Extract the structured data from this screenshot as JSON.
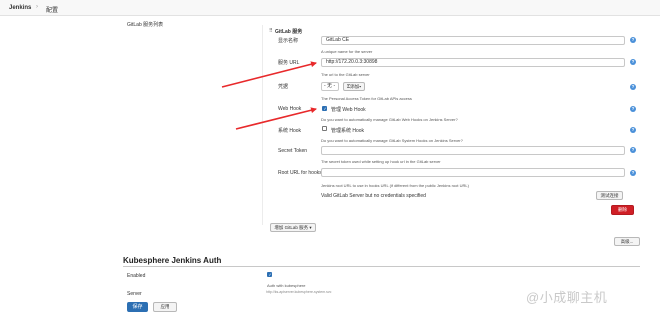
{
  "breadcrumb": {
    "home": "Jenkins",
    "separator": "›",
    "current": "配置"
  },
  "gitlab": {
    "section_label": "GitLab 服务列表",
    "block_title": "GitLab 服务",
    "display_name": {
      "label": "显示名称",
      "value": "GitLab CE",
      "hint": "A unique name for the server"
    },
    "server_url": {
      "label": "服务 URL",
      "value": "http://172.20.0.3:30898",
      "hint": "The url to the GitLab server"
    },
    "credentials": {
      "label": "凭据",
      "select_value": "- 无 -",
      "add_button": "添加",
      "hint": "The Personal Access Token for GitLab APIs access"
    },
    "web_hook": {
      "label": "Web Hook",
      "checkbox_label": "管理 Web Hook",
      "hint": "Do you want to automatically manage GitLab Web Hooks on Jenkins Server?"
    },
    "system_hook": {
      "label": "系统 Hook",
      "checkbox_label": "管理系统 Hook",
      "hint": "Do you want to automatically manage GitLab System Hooks on Jenkins Server?"
    },
    "secret_token": {
      "label": "Secret Token",
      "value": "",
      "hint": "The secret token used while setting up hook url in the GitLab server"
    },
    "root_url": {
      "label": "Root URL for hooks",
      "value": "",
      "hint": "Jenkins root URL to use in hooks URL (if different from the public Jenkins root URL)"
    },
    "status": "Valid GitLab Server but no credentials specified",
    "test_button": "测试连接",
    "delete_button": "删除",
    "add_server_button": "增加 GitLab 服务",
    "advanced_button": "高级..."
  },
  "kubesphere": {
    "title": "Kubesphere Jenkins Auth",
    "enabled_label": "Enabled",
    "auth_label": "Auth with kubesphere",
    "server_label": "Server",
    "server_value": "http://ks-apiserver.kubesphere-system.svc"
  },
  "footer": {
    "save_button": "保存",
    "apply_button": "应用"
  },
  "watermark": "@小成聊主机",
  "colors": {
    "primary": "#2c6fb3",
    "danger": "#d01f26",
    "arrow": "#e8292b",
    "help": "#4a90d9"
  }
}
